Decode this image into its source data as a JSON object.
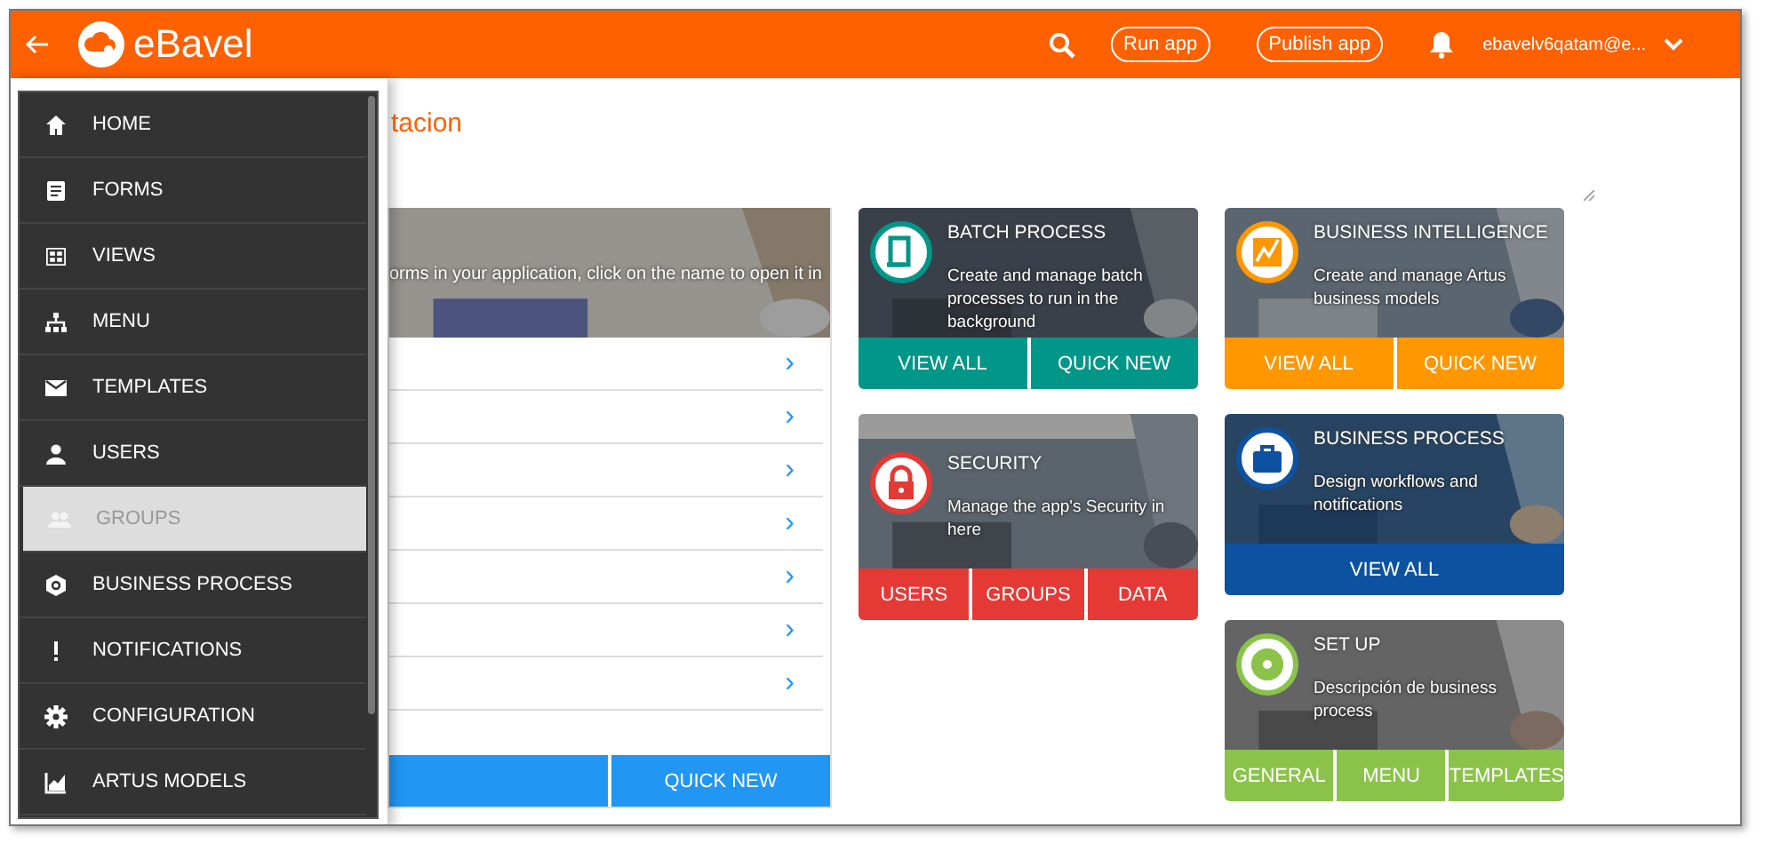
{
  "app": {
    "title": "eBavel"
  },
  "header": {
    "run_button": "Run app",
    "publish_button": "Publish app",
    "user": "ebavelv6qatam@e..."
  },
  "sidebar": {
    "items": [
      {
        "label": "HOME",
        "kind": "home",
        "selected": false
      },
      {
        "label": "FORMS",
        "kind": "form",
        "selected": false
      },
      {
        "label": "VIEWS",
        "kind": "grid",
        "selected": false
      },
      {
        "label": "MENU",
        "kind": "tree",
        "selected": false
      },
      {
        "label": "TEMPLATES",
        "kind": "mail",
        "selected": false
      },
      {
        "label": "USERS",
        "kind": "person",
        "selected": false
      },
      {
        "label": "GROUPS",
        "kind": "people",
        "selected": true
      },
      {
        "label": "BUSINESS PROCESS",
        "kind": "hexagon",
        "selected": false
      },
      {
        "label": "NOTIFICATIONS",
        "kind": "alert",
        "selected": false
      },
      {
        "label": "CONFIGURATION",
        "kind": "gear",
        "selected": false
      },
      {
        "label": "ARTUS MODELS",
        "kind": "chart",
        "selected": false
      }
    ]
  },
  "page": {
    "title": "tacion"
  },
  "forms_card": {
    "description": "orms in your application, click on the name to open it in",
    "rows": [
      {
        "chevron": "›"
      },
      {
        "chevron": "›"
      },
      {
        "chevron": "›"
      },
      {
        "chevron": "›"
      },
      {
        "chevron": "›"
      },
      {
        "chevron": "›"
      },
      {
        "chevron": "›"
      }
    ],
    "buttons": [
      {
        "kind": "blank"
      },
      {
        "kind": "label",
        "label": "QUICK NEW"
      }
    ]
  },
  "tile_columns": [
    [
      {
        "title": "BATCH PROCESS",
        "description": "Create and manage batch processes to run in the background",
        "kind": "batch",
        "color": "#009688",
        "buttons": [
          "VIEW ALL",
          "QUICK NEW"
        ]
      },
      {
        "title": "SECURITY",
        "description": "Manage the app's Security in here",
        "kind": "lock",
        "color": "#e53935",
        "buttons": [
          "USERS",
          "GROUPS",
          "DATA"
        ]
      }
    ],
    [
      {
        "title": "BUSINESS INTELLIGENCE",
        "description": "Create and manage Artus business models",
        "kind": "chart",
        "color": "#ff9800",
        "buttons": [
          "VIEW ALL",
          "QUICK NEW"
        ]
      },
      {
        "title": "BUSINESS PROCESS",
        "description": "Design workflows and notifications",
        "kind": "briefcase",
        "color": "#0d52a0",
        "buttons": [
          "VIEW ALL"
        ]
      },
      {
        "title": "SET UP",
        "description": "Descripción de business process",
        "kind": "gear",
        "color": "#8bc34a",
        "buttons": [
          "GENERAL",
          "MENU",
          "TEMPLATES"
        ]
      }
    ]
  ]
}
